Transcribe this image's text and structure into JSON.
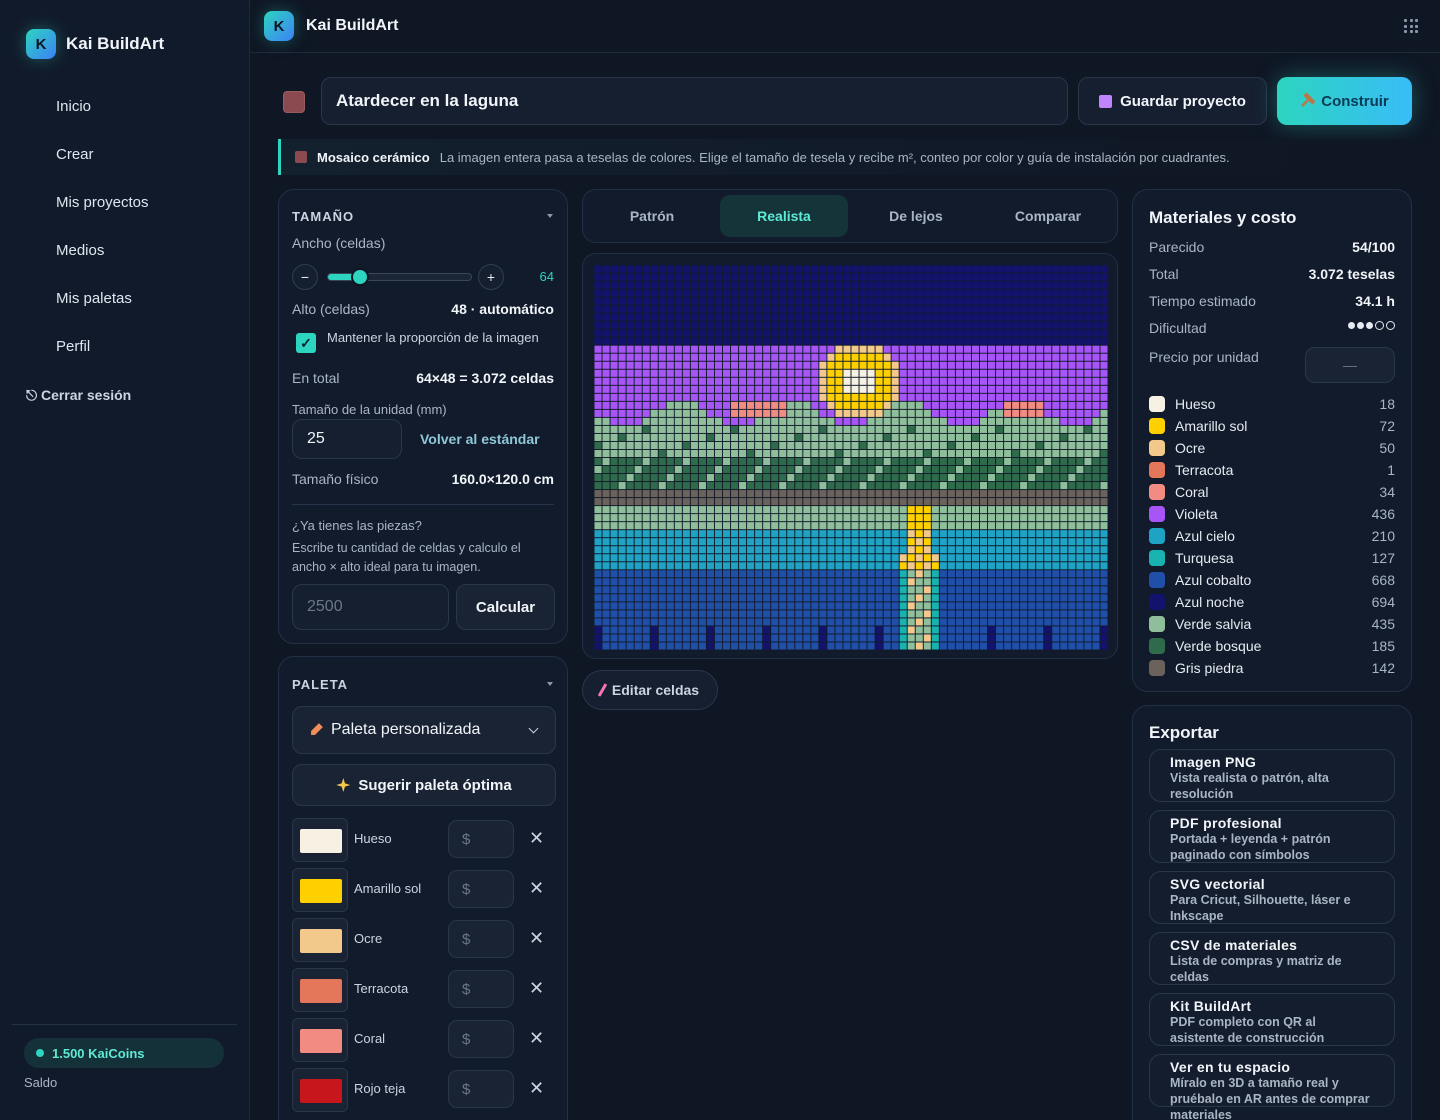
{
  "app": {
    "name": "Kai BuildArt",
    "logo_letter": "K"
  },
  "sidebar": {
    "items": [
      {
        "label": "Inicio",
        "icon": "home-icon",
        "color": "#e07a5f"
      },
      {
        "label": "Crear",
        "icon": "sparkle-icon",
        "color": "#f2c94c"
      },
      {
        "label": "Mis proyectos",
        "icon": "folder-icon",
        "color": "#e9b949"
      },
      {
        "label": "Medios",
        "icon": "puzzle-icon",
        "color": "#6fcf97"
      },
      {
        "label": "Mis paletas",
        "icon": "palette-icon",
        "color": "#f28b82"
      },
      {
        "label": "Perfil",
        "icon": "user-icon",
        "color": "#7c6cf0"
      }
    ],
    "logout_label": "⎋ Cerrar sesión",
    "coins_label": "1.500 KaiCoins",
    "balance_label": "Saldo"
  },
  "project": {
    "title": "Atardecer en la laguna",
    "save_label": "Guardar proyecto",
    "build_label": "Construir",
    "banner_title": "Mosaico cerámico",
    "banner_text": "La imagen entera pasa a teselas de colores. Elige el tamaño de tesela y recibe m², conteo por color y guía de instalación por cuadrantes."
  },
  "size": {
    "heading": "TAMAÑO",
    "width_label": "Ancho (celdas)",
    "width_value": "64",
    "width_fraction": 0.22,
    "height_label": "Alto (celdas)",
    "height_value": "48 · automático",
    "keep_ratio_label": "Mantener la proporción de la imagen",
    "total_label": "En total",
    "total_value": "64×48 = 3.072 celdas",
    "unit_label": "Tamaño de la unidad (mm)",
    "unit_value": "25",
    "reset_label": "Volver al estándar",
    "physical_label": "Tamaño físico",
    "physical_value": "160.0×120.0 cm",
    "pieces_q": "¿Ya tienes las piezas?",
    "pieces_hint": "Escribe tu cantidad de celdas y calculo el ancho × alto ideal para tu imagen.",
    "pieces_placeholder": "2500",
    "calc_label": "Calcular"
  },
  "palette": {
    "heading": "PALETA",
    "selected": "Paleta personalizada",
    "suggest_label": "Sugerir paleta óptima",
    "currency_placeholder": "$",
    "colors": [
      {
        "name": "Hueso",
        "hex": "#f6f1e3"
      },
      {
        "name": "Amarillo sol",
        "hex": "#ffd000"
      },
      {
        "name": "Ocre",
        "hex": "#f3c98b"
      },
      {
        "name": "Terracota",
        "hex": "#e4775a"
      },
      {
        "name": "Coral",
        "hex": "#f28b82"
      },
      {
        "name": "Rojo teja",
        "hex": "#c8161d"
      }
    ]
  },
  "tabs": [
    "Patrón",
    "Realista",
    "De lejos",
    "Comparar"
  ],
  "active_tab": "Realista",
  "edit_label": "Editar celdas",
  "materials": {
    "title": "Materiales y costo",
    "stats": [
      {
        "label": "Parecido",
        "value": "54/100"
      },
      {
        "label": "Total",
        "value": "3.072 teselas"
      },
      {
        "label": "Tiempo estimado",
        "value": "34.1 h"
      }
    ],
    "difficulty_label": "Dificultad",
    "difficulty_level": 3,
    "difficulty_max": 5,
    "unit_price_label": "Precio por unidad",
    "unit_price_placeholder": "—",
    "items": [
      {
        "name": "Hueso",
        "count": "18",
        "hex": "#f6f1e3"
      },
      {
        "name": "Amarillo sol",
        "count": "72",
        "hex": "#ffd000"
      },
      {
        "name": "Ocre",
        "count": "50",
        "hex": "#f3c98b"
      },
      {
        "name": "Terracota",
        "count": "1",
        "hex": "#e4775a"
      },
      {
        "name": "Coral",
        "count": "34",
        "hex": "#f28b82"
      },
      {
        "name": "Violeta",
        "count": "436",
        "hex": "#a855f7"
      },
      {
        "name": "Azul cielo",
        "count": "210",
        "hex": "#1fa3c4"
      },
      {
        "name": "Turquesa",
        "count": "127",
        "hex": "#18b3b0"
      },
      {
        "name": "Azul cobalto",
        "count": "668",
        "hex": "#1f4fa8"
      },
      {
        "name": "Azul noche",
        "count": "694",
        "hex": "#13136e"
      },
      {
        "name": "Verde salvia",
        "count": "435",
        "hex": "#8fbf9a"
      },
      {
        "name": "Verde bosque",
        "count": "185",
        "hex": "#2e6b4a"
      },
      {
        "name": "Gris piedra",
        "count": "142",
        "hex": "#6b625c"
      }
    ]
  },
  "export": {
    "title": "Exportar",
    "items": [
      {
        "title": "Imagen PNG",
        "desc": "Vista realista o patrón, alta resolución"
      },
      {
        "title": "PDF profesional",
        "desc": "Portada + leyenda + patrón paginado con símbolos"
      },
      {
        "title": "SVG vectorial",
        "desc": "Para Cricut, Silhouette, láser e Inkscape"
      },
      {
        "title": "CSV de materiales",
        "desc": "Lista de compras y matriz de celdas"
      },
      {
        "title": "Kit BuildArt",
        "desc": "PDF completo con QR al asistente de construcción"
      },
      {
        "title": "Ver en tu espacio",
        "desc": "Míralo en 3D a tamaño real y pruébalo en AR antes de comprar materiales"
      }
    ]
  }
}
